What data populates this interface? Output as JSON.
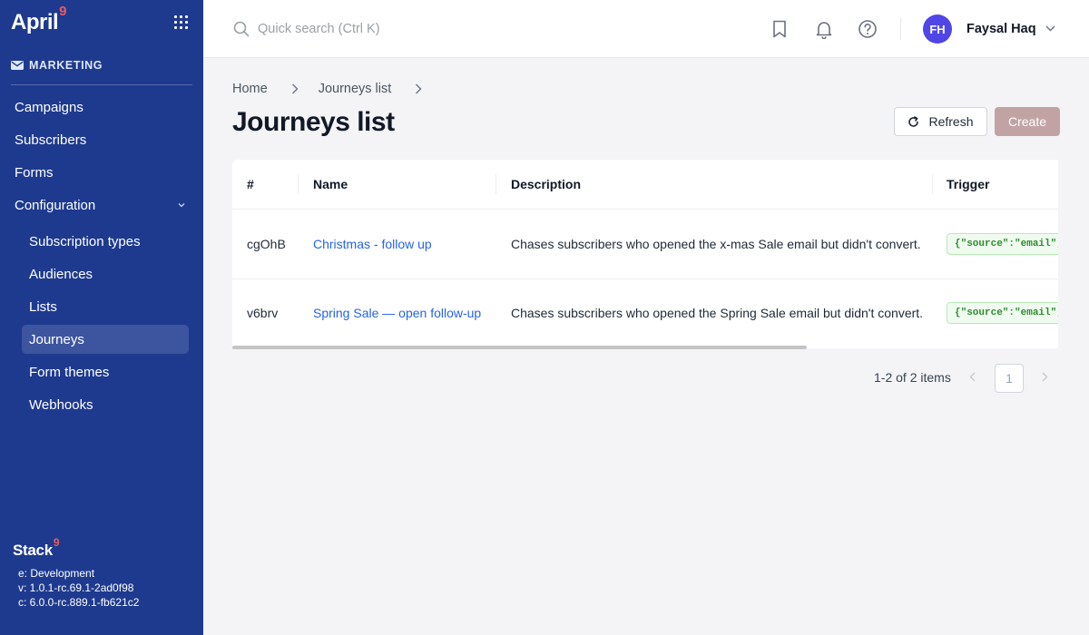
{
  "brand": {
    "name": "April",
    "superscript": "9"
  },
  "sidebar": {
    "section_label": "MARKETING",
    "items": [
      {
        "label": "Campaigns"
      },
      {
        "label": "Subscribers"
      },
      {
        "label": "Forms"
      },
      {
        "label": "Configuration",
        "expanded": true
      }
    ],
    "sub_items": [
      {
        "label": "Subscription types"
      },
      {
        "label": "Audiences"
      },
      {
        "label": "Lists"
      },
      {
        "label": "Journeys",
        "active": true
      },
      {
        "label": "Form themes"
      },
      {
        "label": "Webhooks"
      }
    ],
    "footer": {
      "brand": "Stack",
      "superscript": "9",
      "env": "e: Development",
      "version": "v: 1.0.1-rc.69.1-2ad0f98",
      "core": "c: 6.0.0-rc.889.1-fb621c2"
    }
  },
  "topbar": {
    "search_placeholder": "Quick search (Ctrl K)",
    "user": {
      "initials": "FH",
      "name": "Faysal Haq"
    }
  },
  "breadcrumb": [
    {
      "label": "Home"
    },
    {
      "label": "Journeys list"
    }
  ],
  "page": {
    "title": "Journeys list",
    "refresh_label": "Refresh",
    "create_label": "Create"
  },
  "table": {
    "columns": [
      "#",
      "Name",
      "Description",
      "Trigger"
    ],
    "rows": [
      {
        "id": "cgOhB",
        "name": "Christmas - follow up",
        "description": "Chases subscribers who opened the x-mas Sale email but didn't convert.",
        "trigger": "{\"source\":\"email\",\"typ"
      },
      {
        "id": "v6brv",
        "name": "Spring Sale — open follow-up",
        "description": "Chases subscribers who opened the Spring Sale email but didn't convert.",
        "trigger": "{\"source\":\"email\",\"typ"
      }
    ]
  },
  "pagination": {
    "summary": "1-2 of 2 items",
    "current_page": "1"
  },
  "colors": {
    "sidebar_bg": "#1e3a8f",
    "brand_accent": "#f05a5a",
    "link": "#2563eb",
    "avatar": "#4f46e5",
    "create_button": "#c2a3a3"
  }
}
